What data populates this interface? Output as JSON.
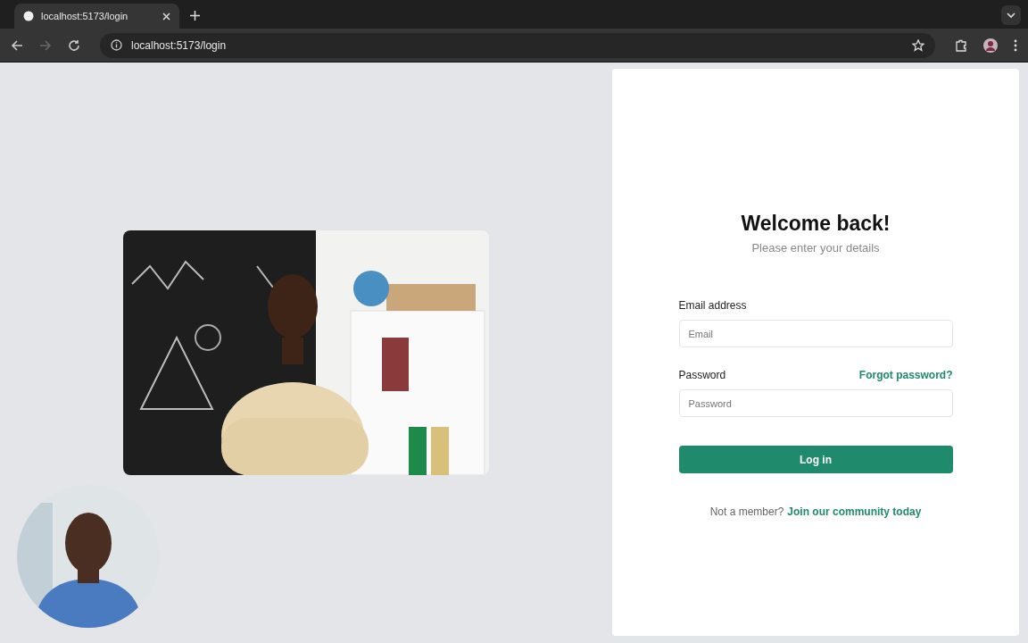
{
  "browser": {
    "tab": {
      "title": "localhost:5173/login",
      "selected": true
    },
    "url": "localhost:5173/login"
  },
  "login": {
    "title": "Welcome back!",
    "subtitle": "Please enter your details",
    "fields": [
      {
        "label": "Email address",
        "placeholder": "Email"
      },
      {
        "label": "Password",
        "placeholder": "Password",
        "link": "Forgot password?"
      }
    ],
    "submit": "Log in",
    "footer": {
      "text": "Not a member?",
      "link": "Join our community today"
    }
  }
}
